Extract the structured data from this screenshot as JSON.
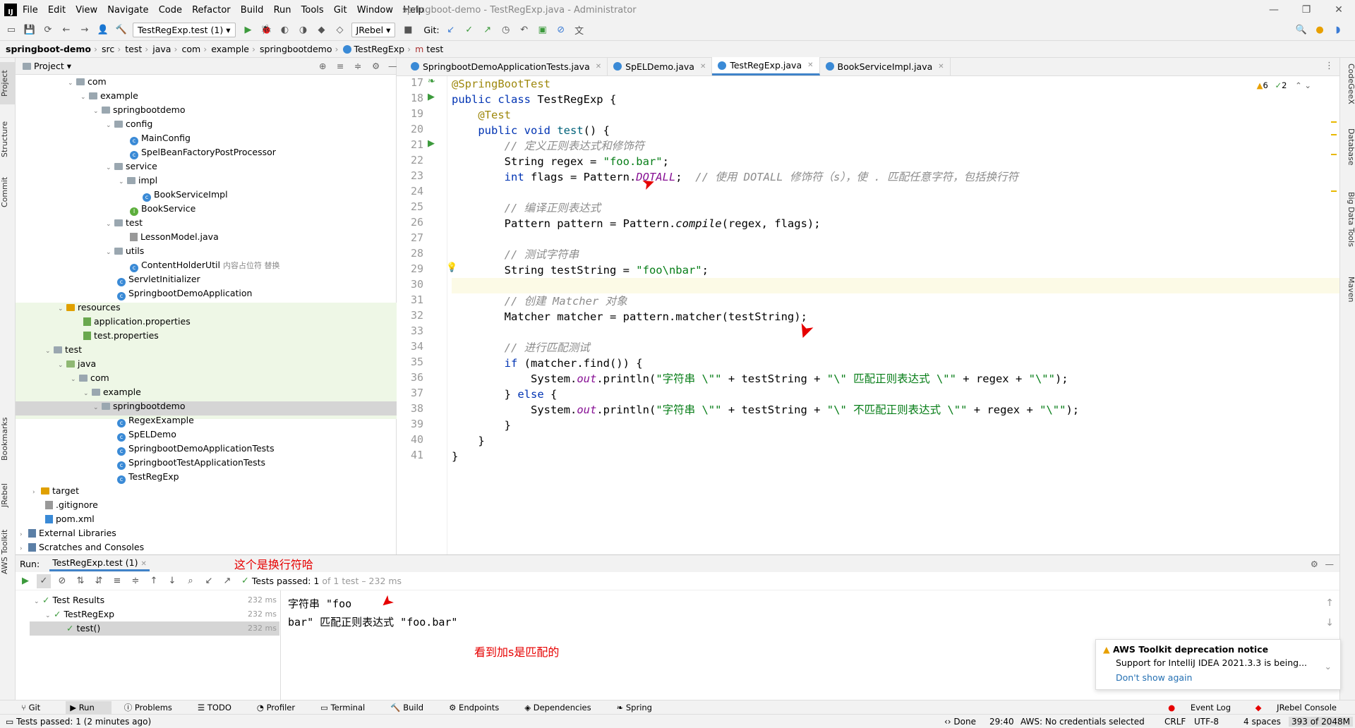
{
  "titlebar": {
    "menu": [
      "File",
      "Edit",
      "View",
      "Navigate",
      "Code",
      "Refactor",
      "Build",
      "Run",
      "Tools",
      "Git",
      "Window",
      "Help"
    ],
    "title": "springboot-demo - TestRegExp.java - Administrator"
  },
  "toolbar": {
    "run_config": "TestRegExp.test (1)",
    "jrebel": "JRebel",
    "git": "Git:"
  },
  "breadcrumb": [
    "springboot-demo",
    "src",
    "test",
    "java",
    "com",
    "example",
    "springbootdemo",
    "TestRegExp",
    "test"
  ],
  "left_strip": [
    "Project",
    "Structure",
    "Commit",
    "Bookmarks",
    "JRebel",
    "AWS Toolkit"
  ],
  "right_strip": [
    "CodeGeeX",
    "Database",
    "Big Data Tools",
    "Maven"
  ],
  "project": {
    "header": "Project",
    "tree": [
      {
        "label": "com",
        "kind": "folder"
      },
      {
        "label": "example",
        "kind": "folder"
      },
      {
        "label": "springbootdemo",
        "kind": "folder"
      },
      {
        "label": "config",
        "kind": "folder"
      },
      {
        "label": "MainConfig",
        "kind": "class"
      },
      {
        "label": "SpelBeanFactoryPostProcessor",
        "kind": "class"
      },
      {
        "label": "service",
        "kind": "folder"
      },
      {
        "label": "impl",
        "kind": "folder"
      },
      {
        "label": "BookServiceImpl",
        "kind": "class"
      },
      {
        "label": "BookService",
        "kind": "interface"
      },
      {
        "label": "test",
        "kind": "folder"
      },
      {
        "label": "LessonModel.java",
        "kind": "file"
      },
      {
        "label": "utils",
        "kind": "folder"
      },
      {
        "label": "ContentHolderUtil",
        "kind": "class",
        "note": "内容占位符 替换"
      },
      {
        "label": "ServletInitializer",
        "kind": "class"
      },
      {
        "label": "SpringbootDemoApplication",
        "kind": "class"
      },
      {
        "label": "resources",
        "kind": "folder"
      },
      {
        "label": "application.properties",
        "kind": "file"
      },
      {
        "label": "test.properties",
        "kind": "file"
      },
      {
        "label": "test",
        "kind": "folder"
      },
      {
        "label": "java",
        "kind": "folder"
      },
      {
        "label": "com",
        "kind": "folder"
      },
      {
        "label": "example",
        "kind": "folder"
      },
      {
        "label": "springbootdemo",
        "kind": "folder"
      },
      {
        "label": "RegexExample",
        "kind": "class"
      },
      {
        "label": "SpELDemo",
        "kind": "class"
      },
      {
        "label": "SpringbootDemoApplicationTests",
        "kind": "class"
      },
      {
        "label": "SpringbootTestApplicationTests",
        "kind": "class"
      },
      {
        "label": "TestRegExp",
        "kind": "class"
      },
      {
        "label": "target",
        "kind": "folder"
      },
      {
        "label": ".gitignore",
        "kind": "file"
      },
      {
        "label": "pom.xml",
        "kind": "file"
      },
      {
        "label": "External Libraries",
        "kind": "lib"
      },
      {
        "label": "Scratches and Consoles",
        "kind": "lib"
      }
    ]
  },
  "editor": {
    "tabs": [
      "SpringbootDemoApplicationTests.java",
      "SpELDemo.java",
      "TestRegExp.java",
      "BookServiceImpl.java"
    ],
    "warnings": "6",
    "checks": "2",
    "lines": [
      "17",
      "18",
      "19",
      "20",
      "21",
      "22",
      "23",
      "24",
      "25",
      "26",
      "27",
      "28",
      "29",
      "30",
      "31",
      "32",
      "33",
      "34",
      "35",
      "36",
      "37",
      "38",
      "39",
      "40",
      "41"
    ]
  },
  "annotations": {
    "newline_note": "这个是换行符哈",
    "match_note": "看到加s是匹配的"
  },
  "run": {
    "label": "Run:",
    "tab": "TestRegExp.test (1)",
    "status": "Tests passed: 1",
    "status_tail": "of 1 test – 232 ms",
    "tree": [
      {
        "label": "Test Results",
        "time": "232 ms"
      },
      {
        "label": "TestRegExp",
        "time": "232 ms"
      },
      {
        "label": "test()",
        "time": "232 ms"
      }
    ],
    "console": [
      "字符串 \"foo",
      "bar\" 匹配正则表达式 \"foo.bar\""
    ]
  },
  "notification": {
    "title": "AWS Toolkit deprecation notice",
    "body": "Support for IntelliJ IDEA 2021.3.3 is being...",
    "link": "Don't show again"
  },
  "bottom_tabs": [
    "Git",
    "Run",
    "Problems",
    "TODO",
    "Profiler",
    "Terminal",
    "Build",
    "Endpoints",
    "Dependencies",
    "Spring"
  ],
  "bottom_right": [
    "Event Log",
    "JRebel Console"
  ],
  "status": {
    "left": "Tests passed: 1 (2 minutes ago)",
    "done": "Done",
    "pos": "29:40",
    "aws": "AWS: No credentials selected",
    "crlf": "CRLF",
    "enc": "UTF-8",
    "indent": "4 spaces",
    "mem": "393 of 2048M"
  }
}
